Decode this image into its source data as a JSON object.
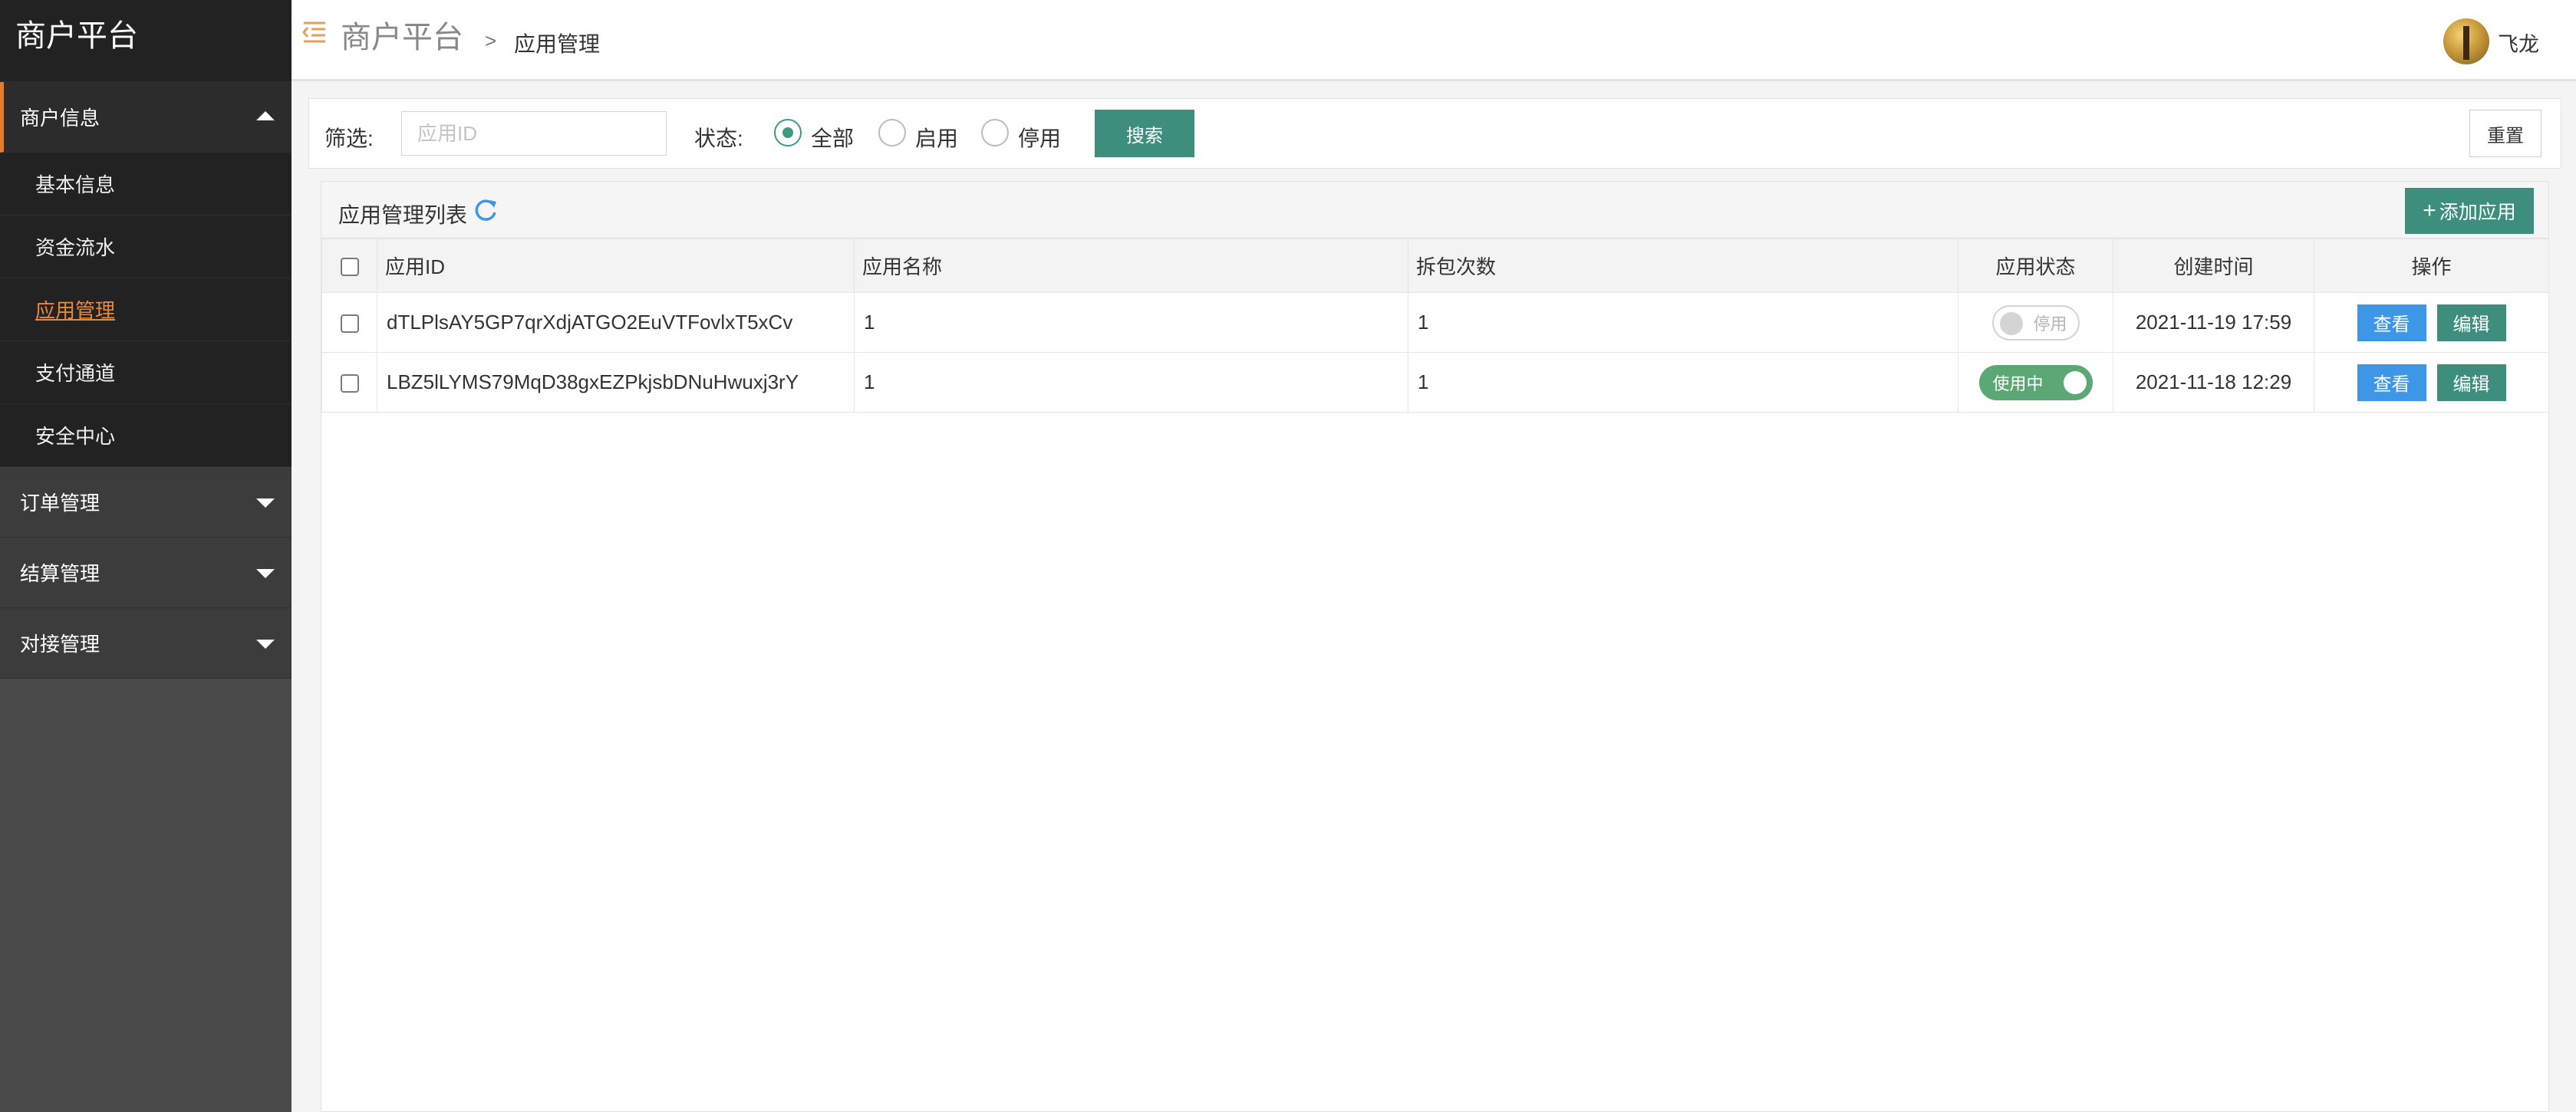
{
  "app": {
    "title": "商户平台"
  },
  "sidebar": {
    "groups": [
      {
        "label": "商户信息",
        "expanded": true,
        "items": [
          {
            "label": "基本信息"
          },
          {
            "label": "资金流水"
          },
          {
            "label": "应用管理",
            "current": true
          },
          {
            "label": "支付通道"
          },
          {
            "label": "安全中心"
          }
        ]
      },
      {
        "label": "订单管理",
        "expanded": false
      },
      {
        "label": "结算管理",
        "expanded": false
      },
      {
        "label": "对接管理",
        "expanded": false
      }
    ]
  },
  "header": {
    "title": "商户平台",
    "breadcrumb_separator": ">",
    "breadcrumb_page": "应用管理",
    "user_name": "飞龙"
  },
  "filter": {
    "label": "筛选:",
    "input_placeholder": "应用ID",
    "input_value": "",
    "status_label": "状态:",
    "radio_options": [
      {
        "label": "全部",
        "checked": true
      },
      {
        "label": "启用",
        "checked": false
      },
      {
        "label": "停用",
        "checked": false
      }
    ],
    "search_button": "搜索",
    "reset_button": "重置"
  },
  "list": {
    "title": "应用管理列表",
    "add_button": "添加应用",
    "columns": [
      "应用ID",
      "应用名称",
      "拆包次数",
      "应用状态",
      "创建时间",
      "操作"
    ],
    "rows": [
      {
        "app_id": "dTLPlsAY5GP7qrXdjATGO2EuVTFovlxT5xCv",
        "app_name": "1",
        "unpack_count": "1",
        "status_text": "停用",
        "status_on": false,
        "created": "2021-11-19 17:59"
      },
      {
        "app_id": "LBZ5lLYMS79MqD38gxEZPkjsbDNuHwuxj3rY",
        "app_name": "1",
        "unpack_count": "1",
        "status_text": "使用中",
        "status_on": true,
        "created": "2021-11-18 12:29"
      }
    ],
    "view_button": "查看",
    "edit_button": "编辑"
  },
  "colors": {
    "accent": "#3e8e7e",
    "active_orange": "#e27e2e",
    "view_blue": "#3d97e6",
    "switch_on": "#5ba874",
    "sidebar_bg": "#4a4a4a"
  }
}
